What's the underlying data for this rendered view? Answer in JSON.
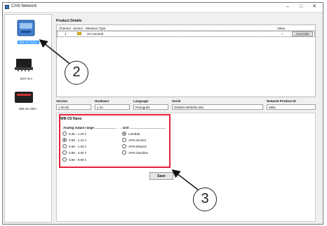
{
  "window": {
    "title": "CAN Network",
    "controls": [
      "–",
      "□",
      "✕"
    ]
  },
  "sidebar": {
    "devices": [
      {
        "label": "WB-O2 Nano",
        "icon": "wb-o2-nano-device-icon",
        "selected": true
      },
      {
        "label": "EGT-8 A",
        "icon": "egt-8-device-icon",
        "selected": false
      },
      {
        "label": "WB-O2 Slim",
        "icon": "wb-o2-slim-device-icon",
        "selected": false
      }
    ]
  },
  "product_details": {
    "title": "Product Details",
    "columns": {
      "channel": "Channel",
      "sensor": "Sensor",
      "measure_type": "Measure Type",
      "value": "Value"
    },
    "rows": [
      {
        "channel": "1",
        "sensor_icon": "sensor-warning-icon",
        "measure_type": "O2 General",
        "value": "---",
        "action": "Associate"
      }
    ]
  },
  "info": {
    "version": {
      "label": "Version",
      "value": "1.00.00"
    },
    "hardware": {
      "label": "Hardware",
      "value": "1.10"
    },
    "language": {
      "label": "Language",
      "value": "Português"
    },
    "serial": {
      "label": "Serial",
      "value": "003842.0000001.001"
    },
    "network_product_id": {
      "label": "Network Product ID",
      "value": "4801"
    }
  },
  "settings": {
    "title": "WB-O2 Nano",
    "analog_range": {
      "title": "Analog output range",
      "options": [
        "0.35 - 1.20 λ",
        "0.59 - 1.10 λ",
        "0.65 - 1.30 λ",
        "0.65 - 4.00 λ",
        "0.65 - 9.99 λ"
      ],
      "selected_index": 1
    },
    "unit": {
      "title": "Unit",
      "options": [
        "Lambda",
        "AFR Alcohol",
        "AFR Ethanol",
        "AFR Gasoline"
      ],
      "selected_index": 0
    },
    "save_label": "Save"
  },
  "callouts": {
    "first": "2",
    "second": "3"
  },
  "colors": {
    "highlight": "#e3203c",
    "selection": "#3399ff",
    "accent": "#3b6fb6"
  }
}
